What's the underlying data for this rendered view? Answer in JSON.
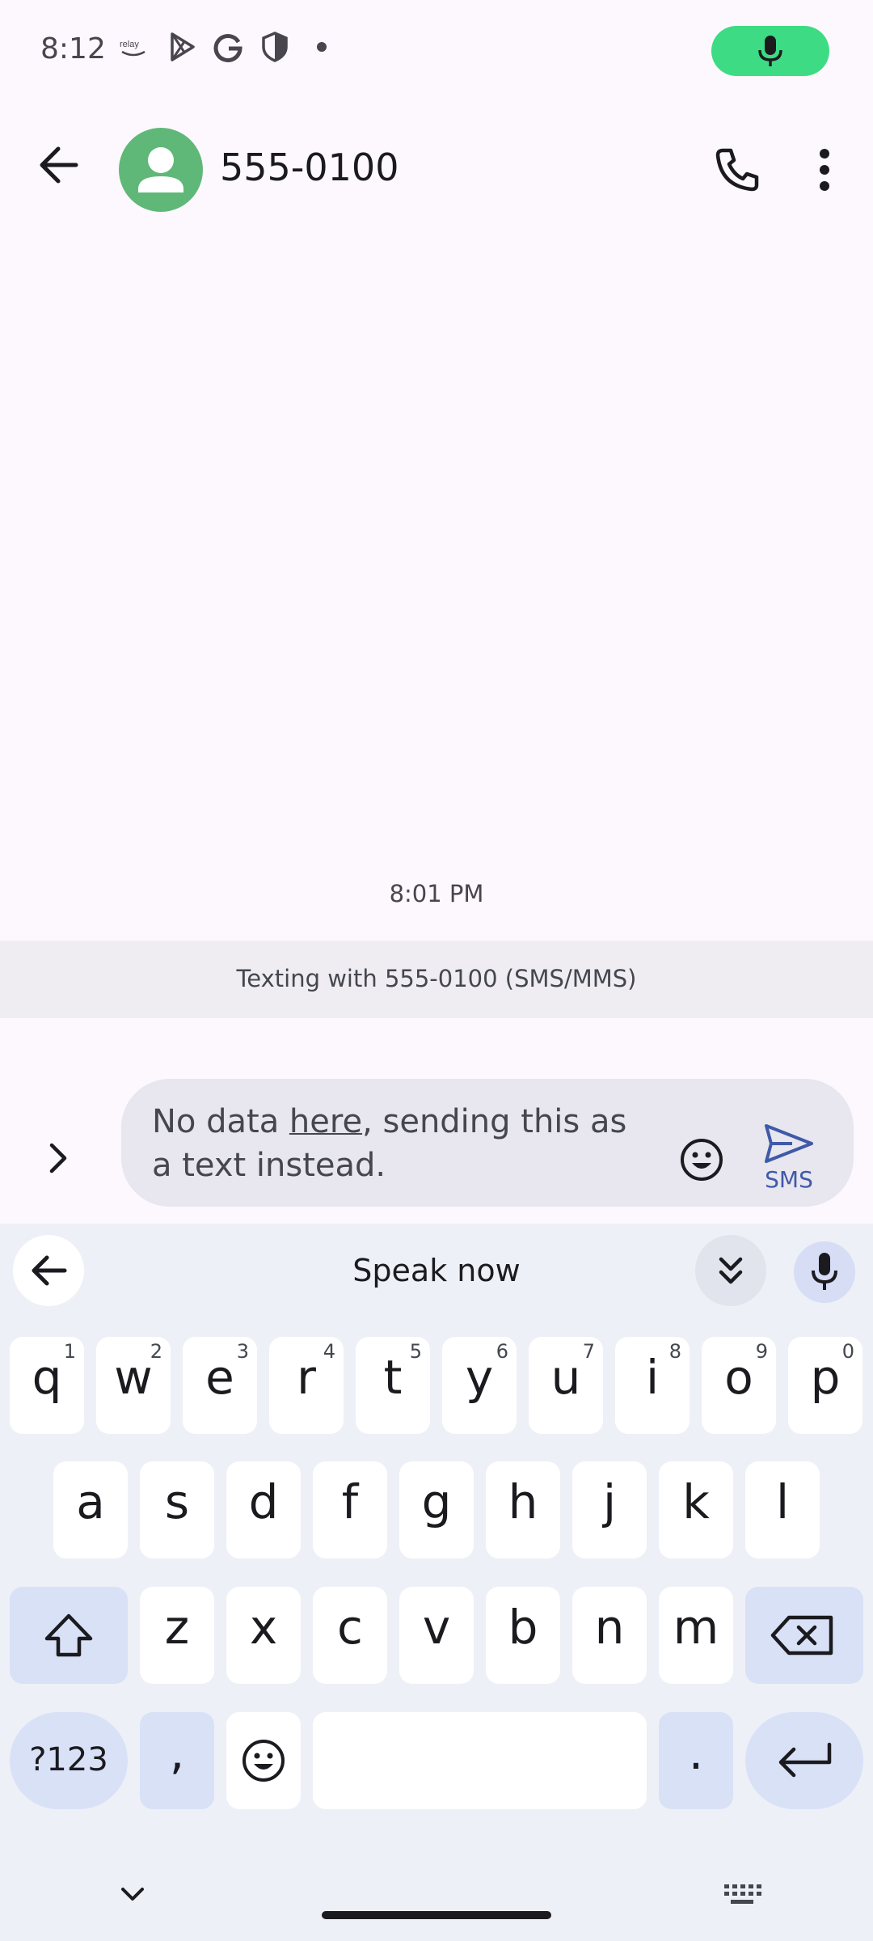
{
  "status_bar": {
    "time": "8:12",
    "icons": [
      "relay-icon",
      "play-store-icon",
      "google-icon",
      "shield-icon",
      "dot-icon"
    ],
    "mic_color": "#3ddc84"
  },
  "top_bar": {
    "contact": "555-0100",
    "avatar_color": "#5fb878"
  },
  "conversation": {
    "timestamp": "8:01 PM",
    "texting_with": "Texting with 555-0100 (SMS/MMS)"
  },
  "compose": {
    "text_before": "No data ",
    "text_underlined": "here",
    "text_after": ", sending this as a text instead.",
    "send_label": "SMS"
  },
  "keyboard": {
    "speak_now": "Speak now",
    "row1": [
      {
        "k": "q",
        "h": "1"
      },
      {
        "k": "w",
        "h": "2"
      },
      {
        "k": "e",
        "h": "3"
      },
      {
        "k": "r",
        "h": "4"
      },
      {
        "k": "t",
        "h": "5"
      },
      {
        "k": "y",
        "h": "6"
      },
      {
        "k": "u",
        "h": "7"
      },
      {
        "k": "i",
        "h": "8"
      },
      {
        "k": "o",
        "h": "9"
      },
      {
        "k": "p",
        "h": "0"
      }
    ],
    "row2": [
      "a",
      "s",
      "d",
      "f",
      "g",
      "h",
      "j",
      "k",
      "l"
    ],
    "row3": [
      "z",
      "x",
      "c",
      "v",
      "b",
      "n",
      "m"
    ],
    "symbols_key": "?123",
    "comma_key": ",",
    "period_key": "."
  }
}
